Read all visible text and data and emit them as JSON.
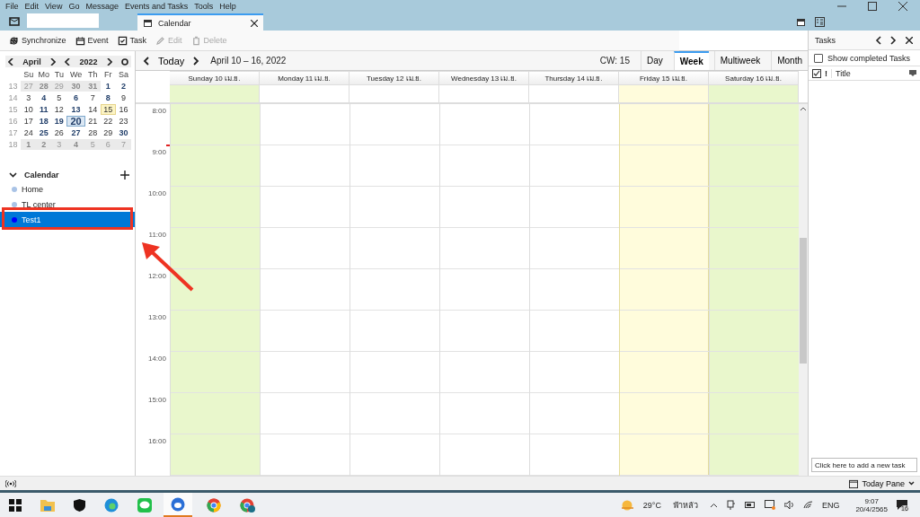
{
  "menu": [
    "File",
    "Edit",
    "View",
    "Go",
    "Message",
    "Events and Tasks",
    "Tools",
    "Help"
  ],
  "tab": {
    "label": "Calendar",
    "selected": true
  },
  "toolbar": [
    {
      "label": "Synchronize",
      "disabled": false
    },
    {
      "label": "Event",
      "disabled": false
    },
    {
      "label": "Task",
      "disabled": false
    },
    {
      "label": "Edit",
      "disabled": true
    },
    {
      "label": "Delete",
      "disabled": true
    }
  ],
  "minical": {
    "month": "April",
    "year": "2022",
    "weekdays": [
      "Su",
      "Mo",
      "Tu",
      "We",
      "Th",
      "Fr",
      "Sa"
    ],
    "weeks": [
      {
        "week": "13",
        "days": [
          {
            "d": "27",
            "kind": "out"
          },
          {
            "d": "28",
            "kind": "out-busy"
          },
          {
            "d": "29",
            "kind": "out"
          },
          {
            "d": "30",
            "kind": "out-busy"
          },
          {
            "d": "31",
            "kind": "out-busy"
          },
          {
            "d": "1",
            "kind": "busy"
          },
          {
            "d": "2",
            "kind": "busy"
          }
        ]
      },
      {
        "week": "14",
        "days": [
          {
            "d": "3",
            "kind": "day"
          },
          {
            "d": "4",
            "kind": "busy"
          },
          {
            "d": "5",
            "kind": "day"
          },
          {
            "d": "6",
            "kind": "busy"
          },
          {
            "d": "7",
            "kind": "day"
          },
          {
            "d": "8",
            "kind": "busy"
          },
          {
            "d": "9",
            "kind": "day"
          }
        ]
      },
      {
        "week": "15",
        "days": [
          {
            "d": "10",
            "kind": "day"
          },
          {
            "d": "11",
            "kind": "busy"
          },
          {
            "d": "12",
            "kind": "day"
          },
          {
            "d": "13",
            "kind": "busy"
          },
          {
            "d": "14",
            "kind": "day"
          },
          {
            "d": "15",
            "kind": "selected"
          },
          {
            "d": "16",
            "kind": "day"
          }
        ]
      },
      {
        "week": "16",
        "days": [
          {
            "d": "17",
            "kind": "day"
          },
          {
            "d": "18",
            "kind": "busy"
          },
          {
            "d": "19",
            "kind": "busy"
          },
          {
            "d": "20",
            "kind": "today"
          },
          {
            "d": "21",
            "kind": "day"
          },
          {
            "d": "22",
            "kind": "day"
          },
          {
            "d": "23",
            "kind": "day"
          }
        ]
      },
      {
        "week": "17",
        "days": [
          {
            "d": "24",
            "kind": "day"
          },
          {
            "d": "25",
            "kind": "busy"
          },
          {
            "d": "26",
            "kind": "day"
          },
          {
            "d": "27",
            "kind": "busy"
          },
          {
            "d": "28",
            "kind": "day"
          },
          {
            "d": "29",
            "kind": "day"
          },
          {
            "d": "30",
            "kind": "busy"
          }
        ]
      },
      {
        "week": "18",
        "days": [
          {
            "d": "1",
            "kind": "out-busy"
          },
          {
            "d": "2",
            "kind": "out-busy"
          },
          {
            "d": "3",
            "kind": "out"
          },
          {
            "d": "4",
            "kind": "out-busy"
          },
          {
            "d": "5",
            "kind": "out"
          },
          {
            "d": "6",
            "kind": "out"
          },
          {
            "d": "7",
            "kind": "out"
          }
        ]
      }
    ]
  },
  "calendars": {
    "title": "Calendar",
    "items": [
      {
        "name": "Home",
        "color": "#a9c3e6",
        "selected": false
      },
      {
        "name": "TL center",
        "color": "#a9c3e6",
        "selected": false
      },
      {
        "name": "Test1",
        "color": "#0000ff",
        "selected": true
      }
    ]
  },
  "nav": {
    "today": "Today",
    "range": "April 10 – 16, 2022",
    "cw": "CW: 15",
    "views": [
      {
        "label": "Day",
        "selected": false
      },
      {
        "label": "Week",
        "selected": true
      },
      {
        "label": "Multiweek",
        "selected": false
      },
      {
        "label": "Month",
        "selected": false
      }
    ]
  },
  "days": [
    {
      "label": "Sunday 10 เม.ย.",
      "kind": "weekend",
      "selected": false
    },
    {
      "label": "Monday 11 เม.ย.",
      "kind": "weekday",
      "selected": false
    },
    {
      "label": "Tuesday 12 เม.ย.",
      "kind": "weekday",
      "selected": false
    },
    {
      "label": "Wednesday 13 เม.ย.",
      "kind": "weekday",
      "selected": false
    },
    {
      "label": "Thursday 14 เม.ย.",
      "kind": "weekday",
      "selected": false
    },
    {
      "label": "Friday 15 เม.ย.",
      "kind": "weekday",
      "selected": true
    },
    {
      "label": "Saturday 16 เม.ย.",
      "kind": "weekend",
      "selected": false
    }
  ],
  "hours": [
    "8:00",
    "9:00",
    "10:00",
    "11:00",
    "12:00",
    "13:00",
    "14:00",
    "15:00",
    "16:00"
  ],
  "tasks": {
    "title": "Tasks",
    "show_completed": {
      "label": "Show completed Tasks",
      "checked": false
    },
    "column_priority": "!",
    "column_title": "Title",
    "new_task_placeholder": "Click here to add a new task"
  },
  "status_bar": {
    "today_pane": "Today Pane"
  },
  "taskbar": {
    "weather": "29°C",
    "condition": "ฟ้าหลัว",
    "language": "ENG",
    "time": "9:07",
    "date": "20/4/2565",
    "notifications": "16"
  }
}
